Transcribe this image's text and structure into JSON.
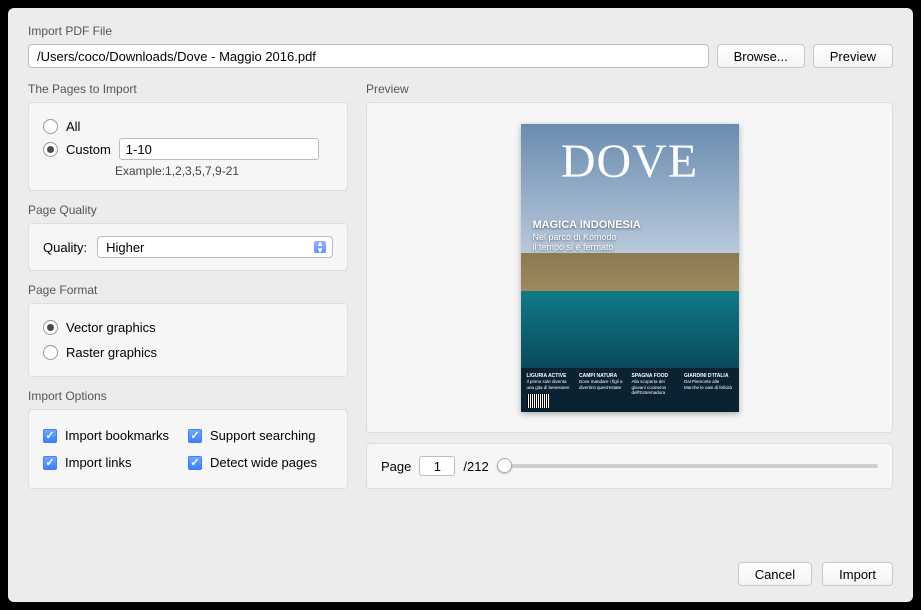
{
  "header": {
    "title": "Import PDF File"
  },
  "file": {
    "path": "/Users/coco/Downloads/Dove - Maggio 2016.pdf",
    "browse_label": "Browse...",
    "preview_label": "Preview"
  },
  "pages": {
    "section_title": "The Pages to Import",
    "all_label": "All",
    "custom_label": "Custom",
    "custom_value": "1-10",
    "example": "Example:1,2,3,5,7,9-21",
    "selected": "custom"
  },
  "quality": {
    "section_title": "Page Quality",
    "label": "Quality:",
    "value": "Higher"
  },
  "format": {
    "section_title": "Page Format",
    "vector_label": "Vector graphics",
    "raster_label": "Raster graphics",
    "selected": "vector"
  },
  "options": {
    "section_title": "Import Options",
    "bookmarks_label": "Import bookmarks",
    "links_label": "Import links",
    "search_label": "Support searching",
    "wide_label": "Detect wide pages",
    "bookmarks": true,
    "links": true,
    "search": true,
    "wide": true
  },
  "preview": {
    "section_title": "Preview",
    "cover_title": "DOVE",
    "headline": "MAGICA INDONESIA",
    "subhead": "Nel parco di Komodo\nil tempo si è fermato",
    "footcols": [
      {
        "h": "LIGURIA ACTIVE",
        "t": "Il primo sole diventa una gita di benessere"
      },
      {
        "h": "CAMPI NATURA",
        "t": "Dove mandare i figli a divertirsi quest'estate"
      },
      {
        "h": "SPAGNA FOOD",
        "t": "Alla scoperta dei giovani cocineros dell'Estremadura"
      },
      {
        "h": "GIARDINI D'ITALIA",
        "t": "Dal Piemonte alle Marche le oasi di felicità"
      }
    ],
    "page_label": "Page",
    "page_value": "1",
    "page_total": "/212"
  },
  "footer": {
    "cancel_label": "Cancel",
    "import_label": "Import"
  }
}
